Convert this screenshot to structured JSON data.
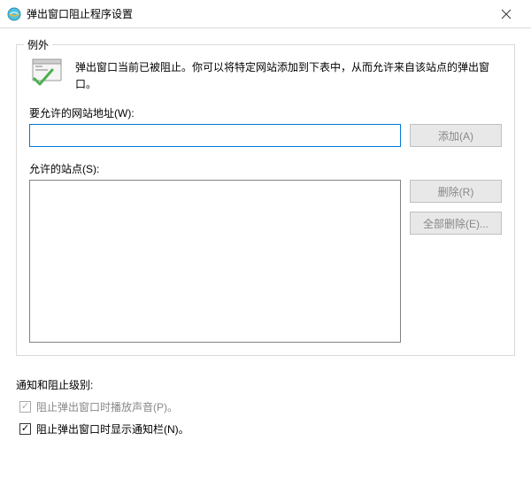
{
  "titlebar": {
    "title": "弹出窗口阻止程序设置"
  },
  "fieldset": {
    "legend": "例外",
    "info_text": "弹出窗口当前已被阻止。你可以将特定网站添加到下表中，从而允许来自该站点的弹出窗口。",
    "address_label": "要允许的网站地址(W):",
    "address_value": "",
    "add_button": "添加(A)",
    "sites_label": "允许的站点(S):",
    "remove_button": "删除(R)",
    "remove_all_button": "全部删除(E)..."
  },
  "notification": {
    "section_label": "通知和阻止级别:",
    "sound_label": "阻止弹出窗口时播放声音(P)。",
    "notify_label": "阻止弹出窗口时显示通知栏(N)。"
  }
}
